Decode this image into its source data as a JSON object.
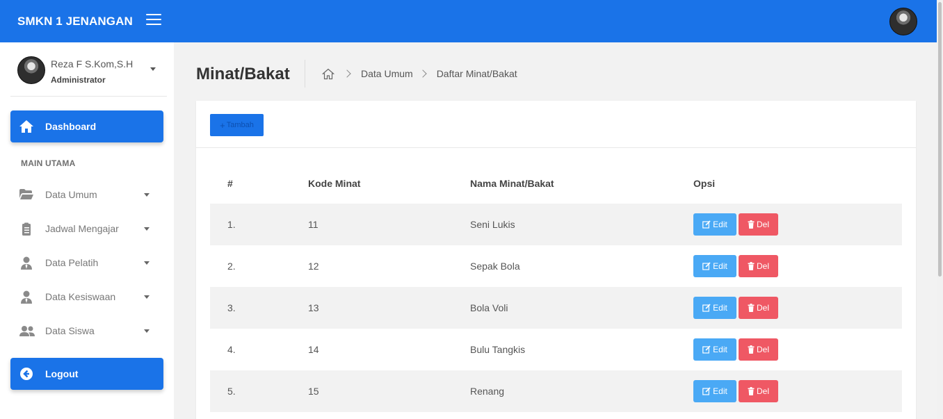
{
  "header": {
    "brand": "SMKN 1 JENANGAN"
  },
  "user": {
    "name": "Reza F S.Kom,S.H",
    "role": "Administrator"
  },
  "sidebar": {
    "dashboard_label": "Dashboard",
    "section_title": "MAIN UTAMA",
    "items": [
      {
        "label": "Data Umum",
        "icon": "folder-open-icon"
      },
      {
        "label": "Jadwal Mengajar",
        "icon": "clipboard-icon"
      },
      {
        "label": "Data Pelatih",
        "icon": "user-tie-icon"
      },
      {
        "label": "Data Kesiswaan",
        "icon": "user-tie-icon"
      },
      {
        "label": "Data Siswa",
        "icon": "users-icon"
      }
    ],
    "logout_label": "Logout"
  },
  "page": {
    "title": "Minat/Bakat",
    "breadcrumb": [
      "Data Umum",
      "Daftar Minat/Bakat"
    ]
  },
  "card": {
    "add_button": "Tambah",
    "columns": [
      "#",
      "Kode Minat",
      "Nama Minat/Bakat",
      "Opsi"
    ],
    "rows": [
      {
        "no": "1.",
        "kode": "11",
        "nama": "Seni Lukis"
      },
      {
        "no": "2.",
        "kode": "12",
        "nama": "Sepak Bola"
      },
      {
        "no": "3.",
        "kode": "13",
        "nama": "Bola Voli"
      },
      {
        "no": "4.",
        "kode": "14",
        "nama": "Bulu Tangkis"
      },
      {
        "no": "5.",
        "kode": "15",
        "nama": "Renang"
      }
    ],
    "edit_label": "Edit",
    "del_label": "Del"
  },
  "colors": {
    "primary": "#1a73e8",
    "edit": "#4aa9f5",
    "delete": "#ef5864"
  }
}
